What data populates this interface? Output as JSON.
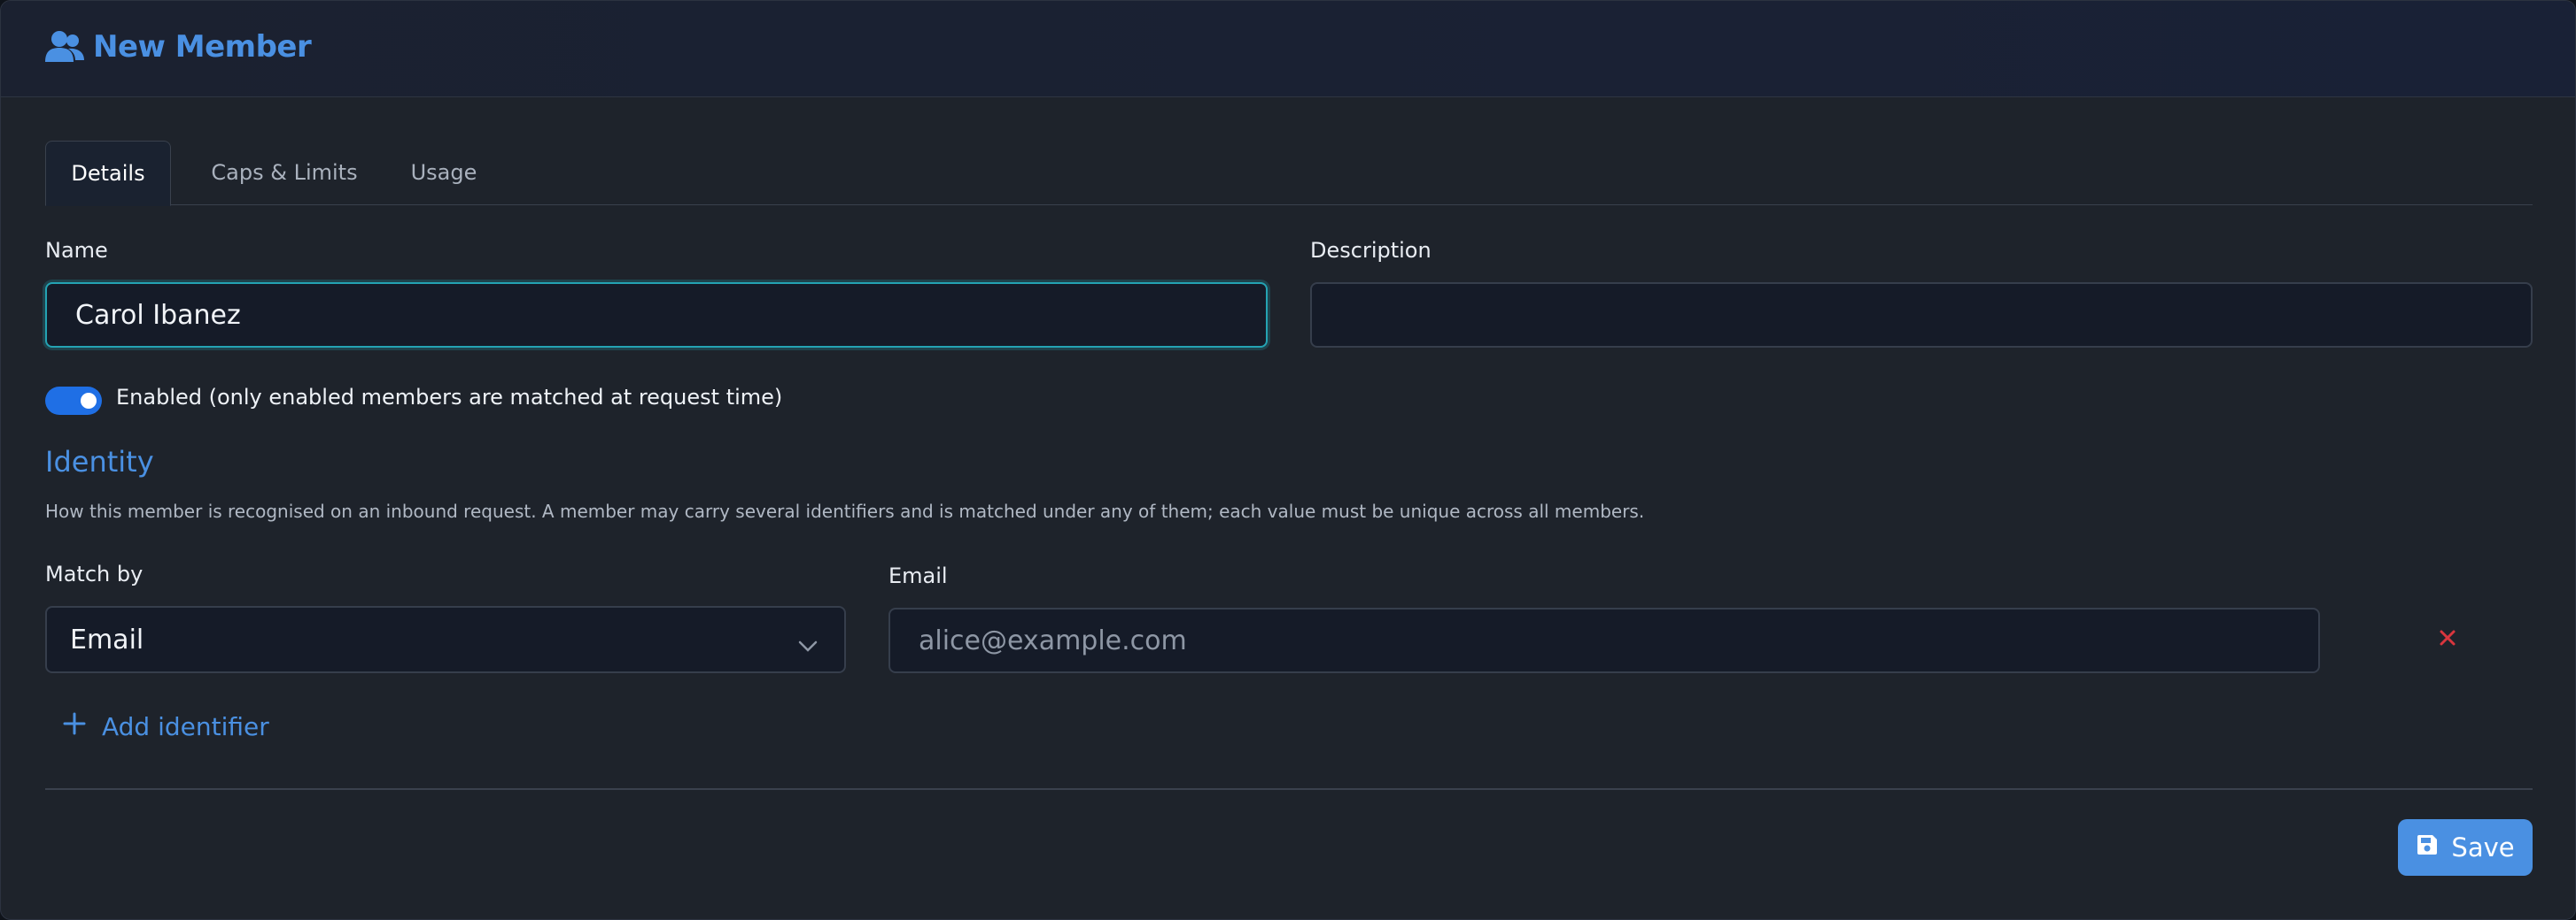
{
  "header": {
    "title": "New Member",
    "icon": "users-icon"
  },
  "tabs": [
    {
      "label": "Details",
      "active": true
    },
    {
      "label": "Caps & Limits",
      "active": false
    },
    {
      "label": "Usage",
      "active": false
    }
  ],
  "form": {
    "name_label": "Name",
    "name_value": "Carol Ibanez",
    "description_label": "Description",
    "description_value": "",
    "enabled": true,
    "enabled_label": "Enabled (only enabled members are matched at request time)"
  },
  "identity": {
    "title": "Identity",
    "description": "How this member is recognised on an inbound request. A member may carry several identifiers and is matched under any of them; each value must be unique across all members.",
    "match_by_label": "Match by",
    "match_by_value": "Email",
    "value_label": "Email",
    "value_placeholder": "alice@example.com",
    "add_label": "Add identifier"
  },
  "footer": {
    "save_label": "Save"
  },
  "colors": {
    "accent": "#4a90e2",
    "focus": "#24a3b3",
    "danger": "#d9363e",
    "toggle": "#1f6fe5"
  }
}
